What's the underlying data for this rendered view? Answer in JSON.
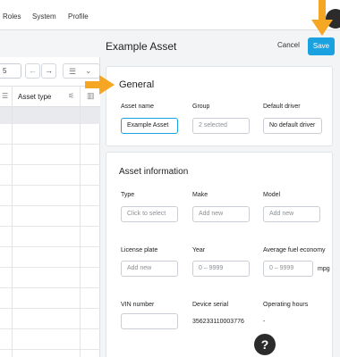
{
  "nav": {
    "items": [
      "Roles",
      "System",
      "Profile"
    ]
  },
  "left_panel": {
    "page_size_select": "5",
    "prev_glyph": "←",
    "next_glyph": "→",
    "view_glyph": "☰",
    "view_chevron": "⌄",
    "column_header": "Asset type"
  },
  "page": {
    "title": "Example Asset",
    "cancel_label": "Cancel",
    "save_label": "Save"
  },
  "general": {
    "title": "General",
    "asset_name_label": "Asset name",
    "asset_name_value": "Example Asset",
    "group_label": "Group",
    "group_value": "2 selected",
    "default_driver_label": "Default driver",
    "default_driver_value": "No default driver"
  },
  "asset_info": {
    "title": "Asset information",
    "type_label": "Type",
    "type_placeholder": "Click to select",
    "make_label": "Make",
    "make_placeholder": "Add new",
    "model_label": "Model",
    "model_placeholder": "Add new",
    "license_plate_label": "License plate",
    "license_plate_placeholder": "Add new",
    "year_label": "Year",
    "year_placeholder": "0 – 9999",
    "fuel_label": "Average fuel economy",
    "fuel_placeholder": "0 – 9999",
    "fuel_unit": "mpg",
    "vin_label": "VIN number",
    "vin_value": "",
    "device_serial_label": "Device serial",
    "device_serial_value": "356233110003776",
    "operating_hours_label": "Operating hours",
    "operating_hours_value": "-"
  },
  "help": {
    "label": "?"
  },
  "colors": {
    "accent": "#1aa2e0",
    "arrow": "#f5a623"
  }
}
